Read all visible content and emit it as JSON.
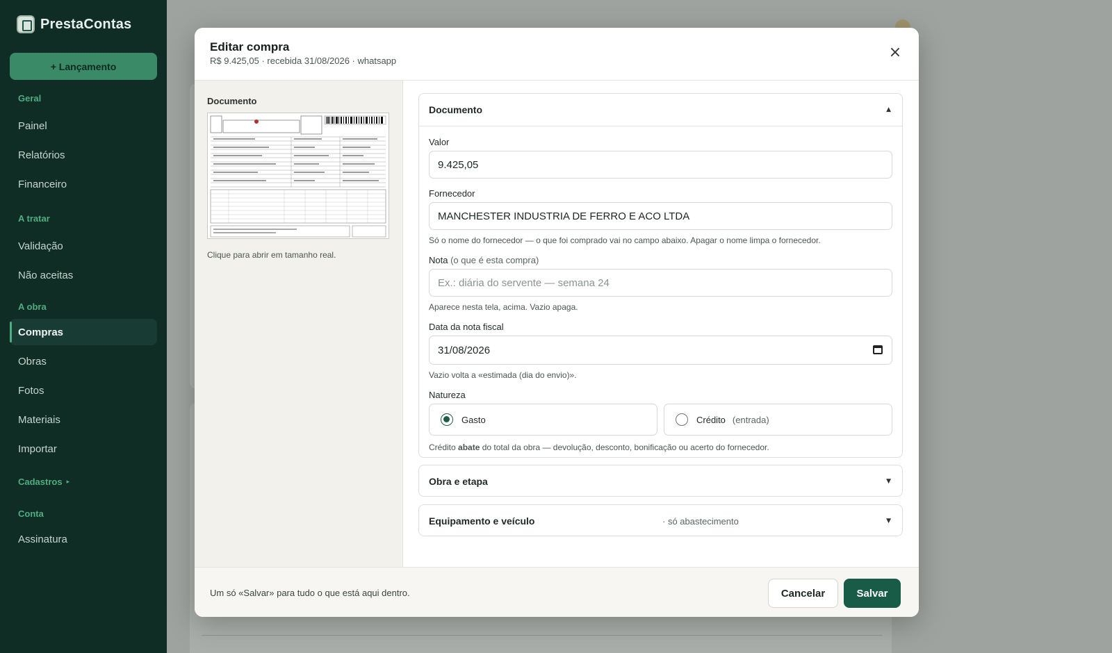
{
  "sidebar": {
    "brand": "PrestaContas",
    "new_entry_label": "+ Lançamento",
    "sections": {
      "geral": "Geral",
      "a_tratar": "A tratar",
      "a_obra": "A obra",
      "cadastros": "Cadastros",
      "conta": "Conta"
    },
    "items": {
      "painel": "Painel",
      "relatorios": "Relatórios",
      "financeiro": "Financeiro",
      "validacao": "Validação",
      "nao_aceitas": "Não aceitas",
      "compras": "Compras",
      "obras": "Obras",
      "fotos": "Fotos",
      "materiais": "Materiais",
      "importar": "Importar",
      "assinatura": "Assinatura"
    },
    "active_item": "compras",
    "cadastros_caret": "▸"
  },
  "modal": {
    "title": "Editar compra",
    "subtitle": "R$ 9.425,05 · recebida 31/08/2026 · whatsapp",
    "close_glyph": "×",
    "document_panel": {
      "label": "Documento",
      "hint": "Clique para abrir em tamanho real."
    },
    "documento_section": {
      "title": "Documento",
      "chevron": "▲",
      "valor_label": "Valor",
      "valor_value": "9.425,05",
      "fornecedor_label": "Fornecedor",
      "fornecedor_value": "MANCHESTER INDUSTRIA DE FERRO E ACO LTDA",
      "fornecedor_help": "Só o nome do fornecedor — o que foi comprado vai no campo abaixo. Apagar o nome limpa o fornecedor.",
      "nota_label": "Nota",
      "nota_label_muted": "(o que é esta compra)",
      "nota_value": "",
      "nota_placeholder": "Ex.: diária do servente — semana 24",
      "nota_help": "Aparece nesta tela, acima. Vazio apaga.",
      "data_label": "Data da nota fiscal",
      "data_value": "31/08/2026",
      "data_help": "Vazio volta a «estimada (dia do envio)».",
      "natureza_label": "Natureza",
      "natureza_options": [
        {
          "label": "Gasto",
          "muted": "",
          "selected": true
        },
        {
          "label": "Crédito",
          "muted": "(entrada)",
          "selected": false
        }
      ],
      "natureza_help_pre": "Crédito ",
      "natureza_help_bold": "abate",
      "natureza_help_post": " do total da obra — devolução, desconto, bonificação ou acerto do fornecedor."
    },
    "obra_section": {
      "title": "Obra e etapa",
      "chevron": "▼"
    },
    "equipamento_section": {
      "title": "Equipamento e veículo",
      "note": "· só abastecimento",
      "chevron": "▼"
    },
    "footer": {
      "text": "Um só «Salvar» para tudo o que está aqui dentro.",
      "cancel_label": "Cancelar",
      "save_label": "Salvar"
    }
  },
  "colors": {
    "sidebar_bg": "#0f2c25",
    "accent": "#3a8a67",
    "primary_button": "#185c47"
  },
  "icons": [
    "app-logo-icon",
    "close-icon",
    "chevron-up-icon",
    "chevron-down-icon",
    "calendar-icon",
    "caret-right-icon"
  ]
}
